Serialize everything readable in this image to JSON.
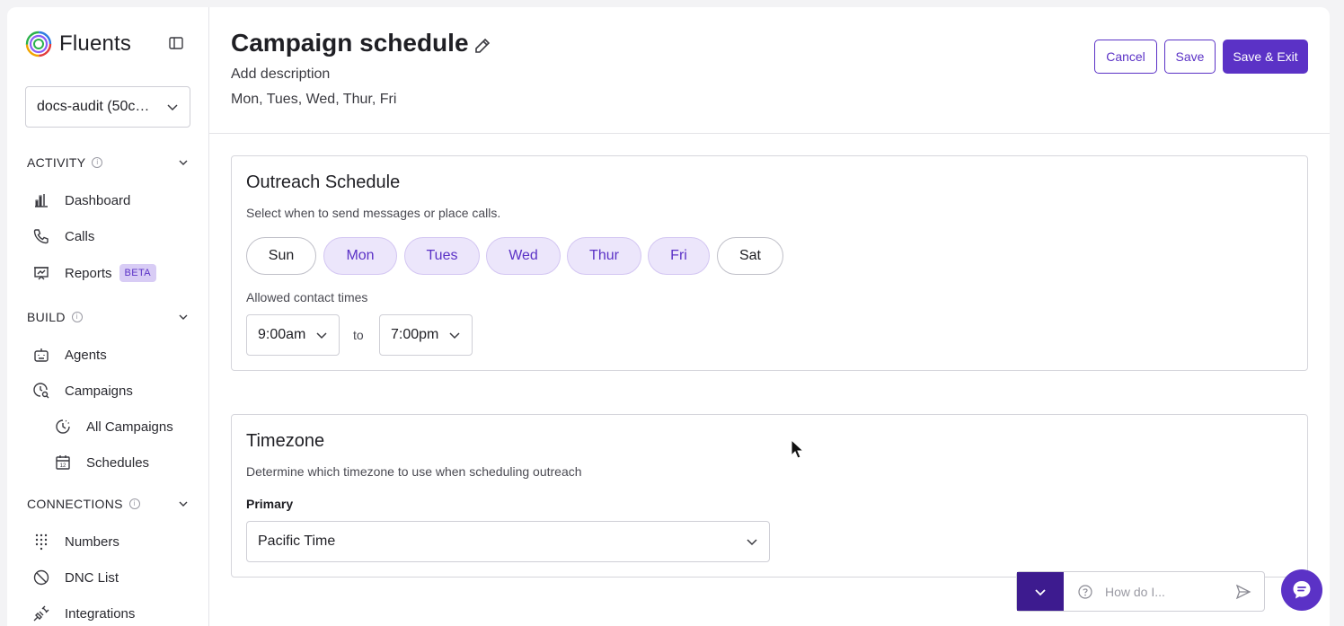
{
  "app": {
    "name": "Fluents"
  },
  "workspace": {
    "label": "docs-audit (50c…"
  },
  "sidebar": {
    "sections": [
      {
        "title": "ACTIVITY"
      },
      {
        "title": "BUILD"
      },
      {
        "title": "CONNECTIONS"
      }
    ],
    "items": [
      {
        "label": "Dashboard",
        "icon": "bar-chart-icon"
      },
      {
        "label": "Calls",
        "icon": "phone-icon"
      },
      {
        "label": "Reports",
        "icon": "presentation-icon",
        "badge": "BETA"
      },
      {
        "label": "Agents",
        "icon": "robot-icon"
      },
      {
        "label": "Campaigns",
        "icon": "clock-search-icon"
      },
      {
        "label": "All Campaigns",
        "icon": "pie-clock-icon"
      },
      {
        "label": "Schedules",
        "icon": "calendar-icon"
      },
      {
        "label": "Numbers",
        "icon": "dialpad-icon"
      },
      {
        "label": "DNC List",
        "icon": "ban-icon"
      },
      {
        "label": "Integrations",
        "icon": "plug-icon"
      }
    ]
  },
  "header": {
    "title": "Campaign schedule",
    "description": "Add description",
    "days_summary": "Mon, Tues, Wed, Thur, Fri",
    "cancel_label": "Cancel",
    "save_label": "Save",
    "save_exit_label": "Save & Exit"
  },
  "outreach": {
    "title": "Outreach Schedule",
    "subtitle": "Select when to send messages or place calls.",
    "days": [
      {
        "label": "Sun",
        "selected": false
      },
      {
        "label": "Mon",
        "selected": true
      },
      {
        "label": "Tues",
        "selected": true
      },
      {
        "label": "Wed",
        "selected": true
      },
      {
        "label": "Thur",
        "selected": true
      },
      {
        "label": "Fri",
        "selected": true
      },
      {
        "label": "Sat",
        "selected": false
      }
    ],
    "times_label": "Allowed contact times",
    "start_time": "9:00am",
    "to_label": "to",
    "end_time": "7:00pm"
  },
  "timezone": {
    "title": "Timezone",
    "subtitle": "Determine which timezone to use when scheduling outreach",
    "primary_label": "Primary",
    "primary_value": "Pacific Time"
  },
  "help": {
    "placeholder": "How do I..."
  },
  "colors": {
    "accent": "#5b32c6",
    "accent_dark": "#3d1b8f",
    "selected_bg": "#ece6fb"
  }
}
